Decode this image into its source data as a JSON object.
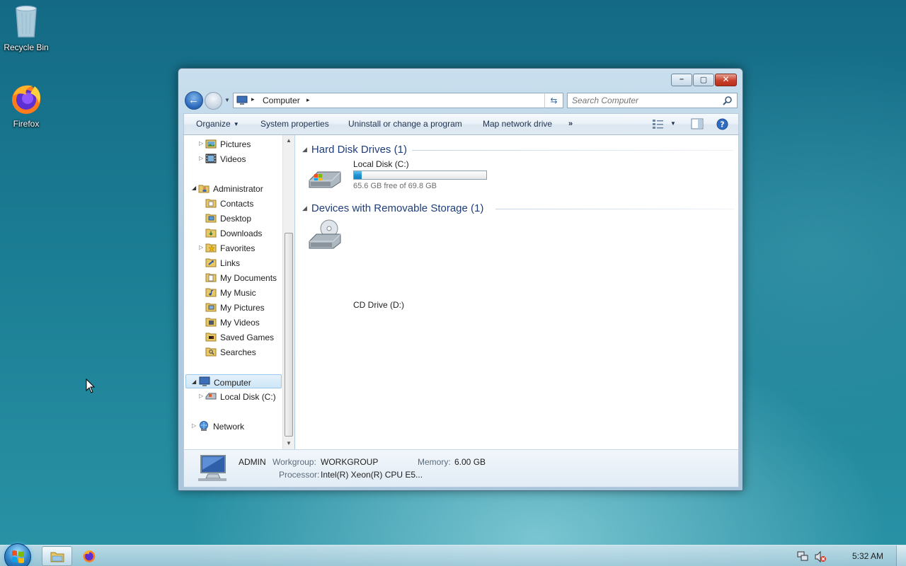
{
  "desktop": {
    "icons": [
      {
        "label": "Recycle Bin",
        "icon": "recycle-bin-icon"
      },
      {
        "label": "Firefox",
        "icon": "firefox-icon"
      }
    ]
  },
  "window": {
    "caption": {
      "minimize": "–",
      "maximize": "▢",
      "close": "✕"
    },
    "address": {
      "crumb": "Computer",
      "sep": "▸"
    },
    "search": {
      "placeholder": "Search Computer"
    },
    "toolbar": {
      "organize": "Organize",
      "system_properties": "System properties",
      "uninstall": "Uninstall or change a program",
      "map_drive": "Map network drive",
      "more": "»"
    },
    "nav_tree": {
      "items": [
        {
          "label": "Pictures"
        },
        {
          "label": "Videos"
        },
        {
          "label": "Administrator"
        },
        {
          "label": "Contacts"
        },
        {
          "label": "Desktop"
        },
        {
          "label": "Downloads"
        },
        {
          "label": "Favorites"
        },
        {
          "label": "Links"
        },
        {
          "label": "My Documents"
        },
        {
          "label": "My Music"
        },
        {
          "label": "My Pictures"
        },
        {
          "label": "My Videos"
        },
        {
          "label": "Saved Games"
        },
        {
          "label": "Searches"
        },
        {
          "label": "Computer"
        },
        {
          "label": "Local Disk (C:)"
        },
        {
          "label": "Network"
        }
      ],
      "selected": "Computer"
    },
    "content": {
      "groups": [
        {
          "title": "Hard Disk Drives (1)",
          "drives": [
            {
              "name": "Local Disk (C:)",
              "free_text": "65.6 GB free of 69.8 GB",
              "used_fraction": 0.06
            }
          ]
        },
        {
          "title": "Devices with Removable Storage (1)",
          "drives": [
            {
              "name": "CD Drive (D:)"
            }
          ]
        }
      ]
    },
    "details": {
      "name": "ADMIN",
      "workgroup_label": "Workgroup:",
      "workgroup_value": "WORKGROUP",
      "memory_label": "Memory:",
      "memory_value": "6.00 GB",
      "processor_label": "Processor:",
      "processor_value": "Intel(R) Xeon(R) CPU E5..."
    }
  },
  "taskbar": {
    "clock": "5:32 AM"
  },
  "colors": {
    "accent": "#1e3d7a",
    "drive_fill": "#1f8fd0"
  }
}
